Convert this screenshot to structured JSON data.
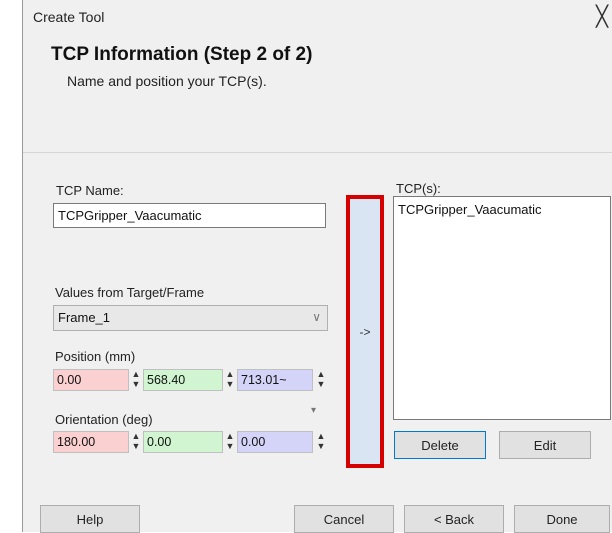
{
  "window": {
    "title": "Create Tool",
    "close_glyph": "╳"
  },
  "header": {
    "title": "TCP Information (Step 2 of 2)",
    "subtitle": "Name and position your TCP(s)."
  },
  "form": {
    "tcp_name_label": "TCP Name:",
    "tcp_name_value": "TCPGripper_Vaacumatic",
    "values_from_label": "Values from Target/Frame",
    "values_from_selected": "Frame_1",
    "position_label": "Position (mm)",
    "position": [
      "0.00",
      "568.40",
      "713.01~"
    ],
    "orientation_label": "Orientation (deg)",
    "orientation": [
      "180.00",
      "0.00",
      "0.00"
    ]
  },
  "add_button": {
    "label": "->"
  },
  "tcps": {
    "label": "TCP(s):",
    "items": [
      "TCPGripper_Vaacumatic"
    ]
  },
  "buttons": {
    "delete": "Delete",
    "edit": "Edit",
    "help": "Help",
    "cancel": "Cancel",
    "back": "< Back",
    "done": "Done"
  },
  "colors": {
    "x_field": "#fbd0d0",
    "y_field": "#d0f5d0",
    "z_field": "#d4d4f8",
    "highlight": "#d60000"
  },
  "icons": {
    "dropdown": "chevron-down-icon",
    "spinner": "spin-updown-icon",
    "close": "close-icon"
  }
}
